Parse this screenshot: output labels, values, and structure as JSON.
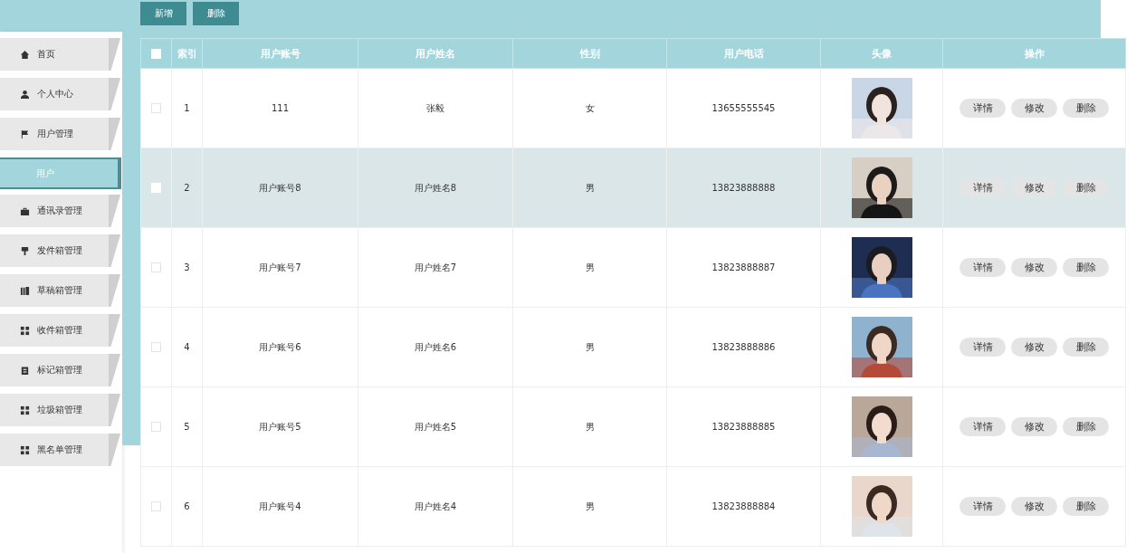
{
  "toolbar": {
    "buttons": [
      "新增",
      "删除"
    ]
  },
  "sidebar": {
    "items": [
      {
        "label": "首页"
      },
      {
        "label": "个人中心"
      },
      {
        "label": "用户管理",
        "children": [
          {
            "label": "用户",
            "selected": true
          }
        ]
      },
      {
        "label": "通讯录管理"
      },
      {
        "label": "发件箱管理"
      },
      {
        "label": "草稿箱管理"
      },
      {
        "label": "收件箱管理"
      },
      {
        "label": "标记箱管理"
      },
      {
        "label": "垃圾箱管理"
      },
      {
        "label": "黑名单管理"
      }
    ]
  },
  "table": {
    "select_all_checked": false,
    "columns": [
      "索引",
      "用户账号",
      "用户姓名",
      "性别",
      "用户电话",
      "头像",
      "操作"
    ],
    "rows": [
      {
        "index": "1",
        "account": "111",
        "name": "张毅",
        "gender": "女",
        "phone": "13655555545",
        "selected": false,
        "checked": false,
        "actions": [
          "详情",
          "修改",
          "删除"
        ]
      },
      {
        "index": "2",
        "account": "用户账号8",
        "name": "用户姓名8",
        "gender": "男",
        "phone": "13823888888",
        "selected": true,
        "checked": false,
        "actions": [
          "详情",
          "修改",
          "删除"
        ]
      },
      {
        "index": "3",
        "account": "用户账号7",
        "name": "用户姓名7",
        "gender": "男",
        "phone": "13823888887",
        "selected": false,
        "checked": false,
        "actions": [
          "详情",
          "修改",
          "删除"
        ]
      },
      {
        "index": "4",
        "account": "用户账号6",
        "name": "用户姓名6",
        "gender": "男",
        "phone": "13823888886",
        "selected": false,
        "checked": false,
        "actions": [
          "详情",
          "修改",
          "删除"
        ]
      },
      {
        "index": "5",
        "account": "用户账号5",
        "name": "用户姓名5",
        "gender": "男",
        "phone": "13823888885",
        "selected": false,
        "checked": false,
        "actions": [
          "详情",
          "修改",
          "删除"
        ]
      },
      {
        "index": "6",
        "account": "用户账号4",
        "name": "用户姓名4",
        "gender": "男",
        "phone": "13823888884",
        "selected": false,
        "checked": false,
        "actions": [
          "详情",
          "修改",
          "删除"
        ]
      }
    ]
  }
}
